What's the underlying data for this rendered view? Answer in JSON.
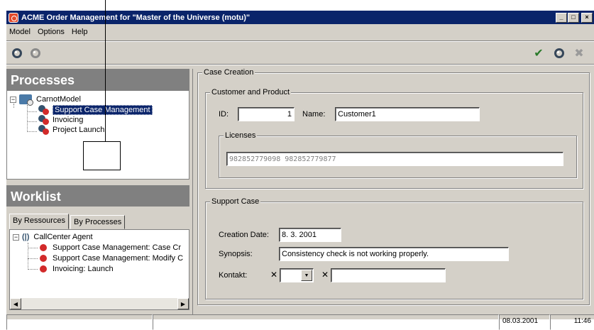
{
  "window": {
    "title": "ACME Order Management for \"Master of the Universe (motu)\""
  },
  "menu": [
    {
      "label": "Model"
    },
    {
      "label": "Options"
    },
    {
      "label": "Help"
    }
  ],
  "window_buttons": {
    "minimize": "_",
    "maximize": "□",
    "close": "×"
  },
  "toolbar": {
    "left_icons": [
      "gear-icon",
      "gear-icon-disabled"
    ],
    "right_icons": [
      "check-icon",
      "gear-icon",
      "x-icon-disabled"
    ],
    "check_glyph": "✔",
    "x_glyph": "✖"
  },
  "processes": {
    "header": "Processes",
    "root_label": "CarnotModel",
    "items": [
      {
        "label": "Support Case Management",
        "selected": true
      },
      {
        "label": "Invoicing",
        "selected": false
      },
      {
        "label": "Project Launch",
        "selected": false
      }
    ],
    "expander": "−"
  },
  "worklist": {
    "header": "Worklist",
    "tabs": [
      {
        "label": "By Ressources",
        "active": true
      },
      {
        "label": "By Processes",
        "active": false
      }
    ],
    "agent_label": "CallCenter Agent",
    "agent_glyph": "(|)",
    "items": [
      {
        "label": "Support Case Management: Case Cr"
      },
      {
        "label": "Support Case Management: Modify C"
      },
      {
        "label": "Invoicing:  Launch"
      }
    ],
    "scroll_left": "◀",
    "scroll_right": "▶"
  },
  "case_creation": {
    "title": "Case Creation",
    "customer_group": {
      "title": "Customer and Product",
      "id_label": "ID:",
      "id_value": "1",
      "name_label": "Name:",
      "name_value": "Customer1",
      "licenses_title": "Licenses",
      "licenses_value": "982852779098    982852779877"
    },
    "support_group": {
      "title": "Support Case",
      "creation_date_label": "Creation Date:",
      "creation_date_value": "8. 3. 2001",
      "synopsis_label": "Synopsis:",
      "synopsis_value": "Consistency check is not working properly.",
      "kontakt_label": "Kontakt:",
      "x_mark": "✕",
      "dropdown_arrow": "▼"
    }
  },
  "statusbar": {
    "date": "08.03.2001",
    "time": "11:46"
  }
}
